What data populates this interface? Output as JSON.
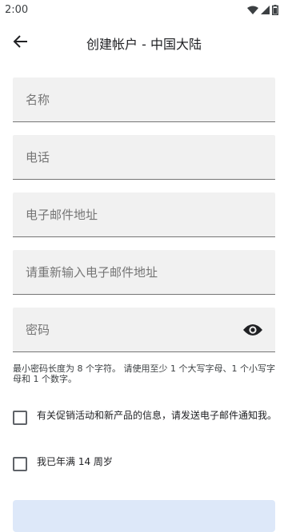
{
  "status_bar": {
    "time": "2:00"
  },
  "header": {
    "title": "创建帐户 - 中国大陆"
  },
  "form": {
    "name_placeholder": "名称",
    "phone_placeholder": "电话",
    "email_placeholder": "电子邮件地址",
    "email_confirm_placeholder": "请重新输入电子邮件地址",
    "password_placeholder": "密码",
    "password_hint": "最小密码长度为 8 个字符。 请使用至少 1 个大写字母、1 个小写字母和 1 个数字。",
    "promo_checkbox_label": "有关促销活动和新产品的信息，请发送电子邮件通知我。",
    "age_checkbox_label": "我已年满 14 周岁"
  },
  "icons": {
    "back": "arrow-back-icon",
    "password_visibility": "eye-icon",
    "wifi": "wifi-icon",
    "signal": "signal-icon",
    "battery": "battery-icon"
  },
  "colors": {
    "field_background": "#f1f1f1",
    "submit_button_background": "#dde8f9"
  }
}
